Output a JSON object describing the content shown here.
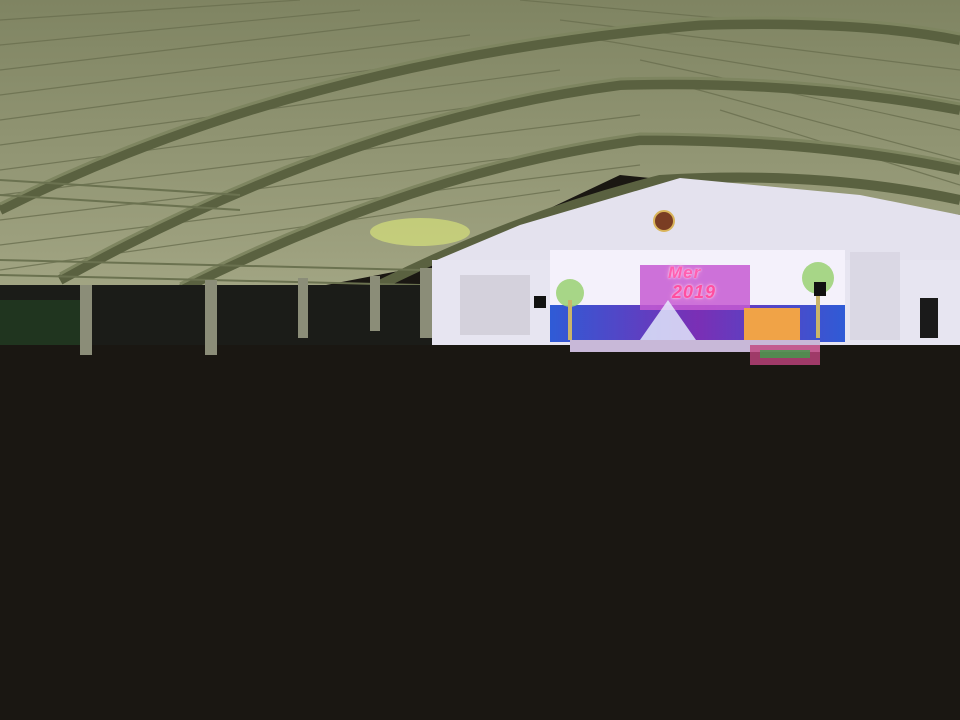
{
  "scene": {
    "description_free": true,
    "stage_banner": {
      "line1": "Mer",
      "line2": "2019"
    },
    "colors": {
      "roof": "#8a8e6a",
      "truss": "#5f6644",
      "stage_wall": "#e9e7f3",
      "stage_backdrop": "#2a4bb8",
      "floor": "#b9a9a0",
      "crowd_dark": "#2b1f18",
      "partition": "#a9a9a2",
      "balloon_pink": "#ff6fb5",
      "balloon_blue": "#3a66ff",
      "costume_green": "#7ccf2d",
      "costume_yellow": "#f2d21b"
    }
  }
}
